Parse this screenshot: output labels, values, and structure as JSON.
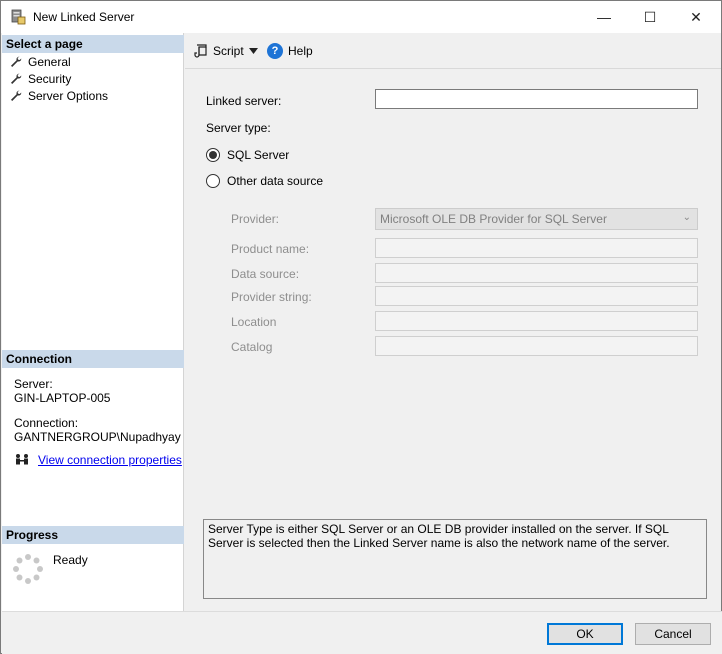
{
  "window": {
    "title": "New Linked Server",
    "controls": {
      "minimize": "—",
      "maximize": "☐",
      "close": "✕"
    }
  },
  "left": {
    "select_page_header": "Select a page",
    "pages": [
      {
        "label": "General",
        "icon": "wrench-icon"
      },
      {
        "label": "Security",
        "icon": "wrench-icon"
      },
      {
        "label": "Server Options",
        "icon": "wrench-icon"
      }
    ],
    "connection_header": "Connection",
    "server_label": "Server:",
    "server_value": "GIN-LAPTOP-005",
    "connection_label": "Connection:",
    "connection_value": "GANTNERGROUP\\Nupadhyay",
    "view_props_link": "View connection properties",
    "progress_header": "Progress",
    "progress_status": "Ready"
  },
  "toolbar": {
    "script_label": "Script",
    "help_label": "Help",
    "help_glyph": "?"
  },
  "form": {
    "linked_server_label": "Linked server:",
    "linked_server_value": "",
    "server_type_label": "Server type:",
    "radio_sql_server": "SQL Server",
    "radio_other": "Other data source",
    "selected_server_type": "SQL Server",
    "provider_label": "Provider:",
    "provider_value": "Microsoft OLE DB Provider for SQL Server",
    "product_name_label": "Product name:",
    "data_source_label": "Data source:",
    "provider_string_label": "Provider string:",
    "location_label": "Location",
    "catalog_label": "Catalog"
  },
  "info_text": "Server Type is either SQL Server or an OLE DB provider installed on the server. If SQL Server is selected then the Linked Server name is also the network name of the server.",
  "buttons": {
    "ok": "OK",
    "cancel": "Cancel"
  },
  "colors": {
    "section_header_bg": "#c9d9ea",
    "accent": "#0078d7",
    "link": "#0000ee",
    "help_icon": "#1e74d6"
  }
}
